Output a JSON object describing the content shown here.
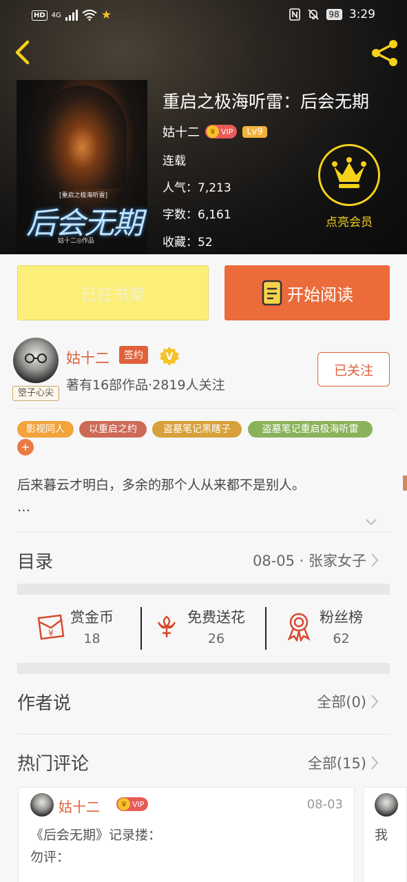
{
  "status_bar": {
    "hd": "HD",
    "network": "4G",
    "battery": "98",
    "time": "3:29"
  },
  "book": {
    "title": "重启之极海听雷：后会无期",
    "author": "姑十二",
    "vip": "VIP",
    "level": "Lv9",
    "status": "连载",
    "popularity": "人气：7,213",
    "word_count": "字数：6,161",
    "favorites": "收藏：52",
    "cover": {
      "small_title": "[重启之极海听雷]",
      "big_title": "后会无期",
      "author_line": "姑十二◎作品"
    }
  },
  "member": {
    "label": "点亮会员"
  },
  "actions": {
    "shelf": "已在书架",
    "read": "开始阅读"
  },
  "author_section": {
    "avatar_tag": "箜子心尖",
    "name": "姑十二",
    "signed": "签约",
    "verified": "V",
    "stats": "著有16部作品·2819人关注",
    "follow": "已关注"
  },
  "tags": [
    "影视同人",
    "以重启之约",
    "盗墓笔记黑瞎子",
    "盗墓笔记重启极海听雷"
  ],
  "tag_add": "+",
  "description": {
    "line1": "后来暮云才明白，多余的那个人从来都不是别人。",
    "line2": "…"
  },
  "toc": {
    "label": "目录",
    "latest": "08-05 · 张家女子"
  },
  "stats": [
    {
      "label": "赏金币",
      "value": "18"
    },
    {
      "label": "免费送花",
      "value": "26"
    },
    {
      "label": "粉丝榜",
      "value": "62"
    }
  ],
  "author_says": {
    "label": "作者说",
    "all": "全部(0)"
  },
  "comments": {
    "label": "热门评论",
    "all": "全部(15)",
    "items": [
      {
        "user": "姑十二",
        "vip": "VIP",
        "date": "08-03",
        "line1": "《后会无期》记录搂：",
        "line2": "勿评："
      },
      {
        "line1": "我"
      }
    ]
  },
  "colors": {
    "accent": "#e0603a",
    "read_button": "#eb6b3b",
    "shelf_button": "#fbef7a",
    "crown": "#f5d21a"
  }
}
